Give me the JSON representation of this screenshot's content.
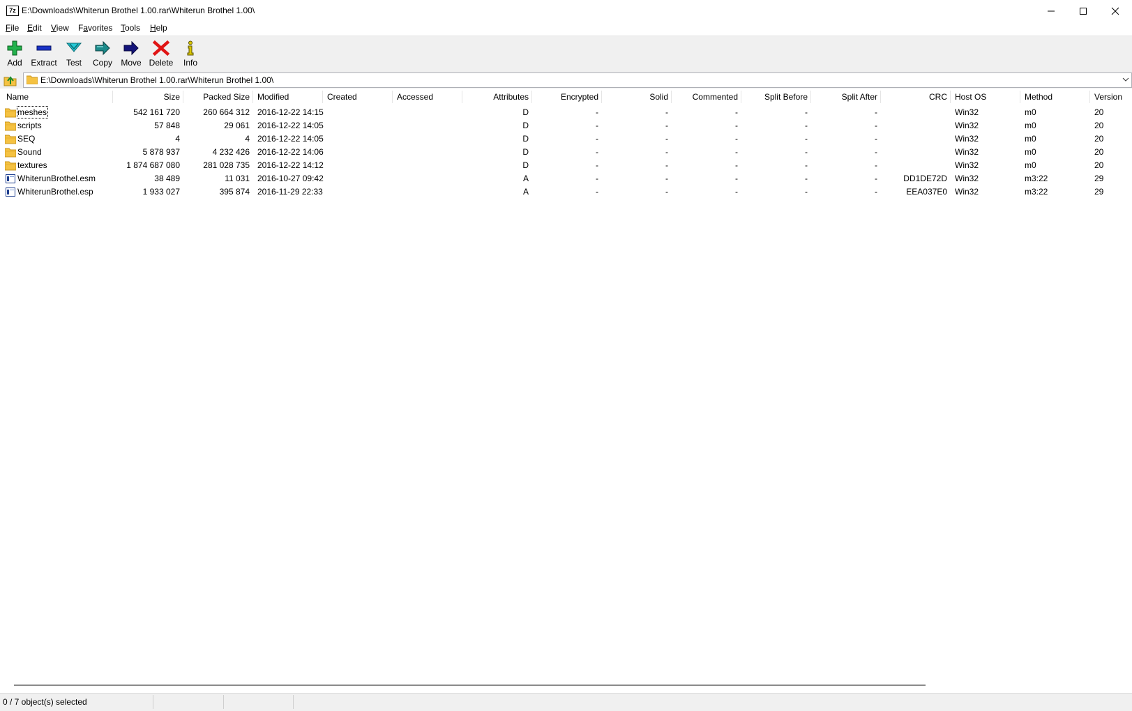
{
  "window": {
    "title": "E:\\Downloads\\Whiterun Brothel 1.00.rar\\Whiterun Brothel 1.00\\",
    "app_icon_text": "7z",
    "controls": [
      "minimize-icon",
      "maximize-icon",
      "close-icon"
    ]
  },
  "menu": {
    "items": [
      {
        "ul": "F",
        "rest": "ile"
      },
      {
        "ul": "E",
        "rest": "dit"
      },
      {
        "ul": "V",
        "rest": "iew"
      },
      {
        "pre": "F",
        "ul": "a",
        "rest": "vorites"
      },
      {
        "ul": "T",
        "rest": "ools"
      },
      {
        "ul": "H",
        "rest": "elp"
      }
    ]
  },
  "toolbar": {
    "buttons": [
      {
        "label": "Add",
        "icon": "plus-icon",
        "color": "#22b14c"
      },
      {
        "label": "Extract",
        "icon": "minus-icon",
        "color": "#1a32c8"
      },
      {
        "label": "Test",
        "icon": "check-chevron-icon",
        "color": "#26c9d6"
      },
      {
        "label": "Copy",
        "icon": "copy-arrow-icon",
        "color": "#1b8a8a"
      },
      {
        "label": "Move",
        "icon": "move-arrow-icon",
        "color": "#14147a"
      },
      {
        "label": "Delete",
        "icon": "delete-x-icon",
        "color": "#e01515"
      },
      {
        "label": "Info",
        "icon": "info-icon",
        "color": "#d8c400"
      }
    ]
  },
  "address": {
    "path": "E:\\Downloads\\Whiterun Brothel 1.00.rar\\Whiterun Brothel 1.00\\"
  },
  "columns": [
    "Name",
    "Size",
    "Packed Size",
    "Modified",
    "Created",
    "Accessed",
    "Attributes",
    "Encrypted",
    "Solid",
    "Commented",
    "Split Before",
    "Split After",
    "CRC",
    "Host OS",
    "Method",
    "Version"
  ],
  "files": [
    {
      "type": "folder",
      "name": "meshes",
      "size": "542 161 720",
      "packed": "260 664 312",
      "modified": "2016-12-22 14:15",
      "created": "",
      "accessed": "",
      "attributes": "D",
      "encrypted": "-",
      "solid": "-",
      "commented": "-",
      "split_before": "-",
      "split_after": "-",
      "crc": "",
      "host_os": "Win32",
      "method": "m0",
      "version": "20"
    },
    {
      "type": "folder",
      "name": "scripts",
      "size": "57 848",
      "packed": "29 061",
      "modified": "2016-12-22 14:05",
      "created": "",
      "accessed": "",
      "attributes": "D",
      "encrypted": "-",
      "solid": "-",
      "commented": "-",
      "split_before": "-",
      "split_after": "-",
      "crc": "",
      "host_os": "Win32",
      "method": "m0",
      "version": "20"
    },
    {
      "type": "folder",
      "name": "SEQ",
      "size": "4",
      "packed": "4",
      "modified": "2016-12-22 14:05",
      "created": "",
      "accessed": "",
      "attributes": "D",
      "encrypted": "-",
      "solid": "-",
      "commented": "-",
      "split_before": "-",
      "split_after": "-",
      "crc": "",
      "host_os": "Win32",
      "method": "m0",
      "version": "20"
    },
    {
      "type": "folder",
      "name": "Sound",
      "size": "5 878 937",
      "packed": "4 232 426",
      "modified": "2016-12-22 14:06",
      "created": "",
      "accessed": "",
      "attributes": "D",
      "encrypted": "-",
      "solid": "-",
      "commented": "-",
      "split_before": "-",
      "split_after": "-",
      "crc": "",
      "host_os": "Win32",
      "method": "m0",
      "version": "20"
    },
    {
      "type": "folder",
      "name": "textures",
      "size": "1 874 687 080",
      "packed": "281 028 735",
      "modified": "2016-12-22 14:12",
      "created": "",
      "accessed": "",
      "attributes": "D",
      "encrypted": "-",
      "solid": "-",
      "commented": "-",
      "split_before": "-",
      "split_after": "-",
      "crc": "",
      "host_os": "Win32",
      "method": "m0",
      "version": "20"
    },
    {
      "type": "file",
      "name": "WhiterunBrothel.esm",
      "size": "38 489",
      "packed": "11 031",
      "modified": "2016-10-27 09:42",
      "created": "",
      "accessed": "",
      "attributes": "A",
      "encrypted": "-",
      "solid": "-",
      "commented": "-",
      "split_before": "-",
      "split_after": "-",
      "crc": "DD1DE72D",
      "host_os": "Win32",
      "method": "m3:22",
      "version": "29"
    },
    {
      "type": "file",
      "name": "WhiterunBrothel.esp",
      "size": "1 933 027",
      "packed": "395 874",
      "modified": "2016-11-29 22:33",
      "created": "",
      "accessed": "",
      "attributes": "A",
      "encrypted": "-",
      "solid": "-",
      "commented": "-",
      "split_before": "-",
      "split_after": "-",
      "crc": "EEA037E0",
      "host_os": "Win32",
      "method": "m3:22",
      "version": "29"
    }
  ],
  "status": {
    "selected": "0 / 7 object(s) selected"
  }
}
